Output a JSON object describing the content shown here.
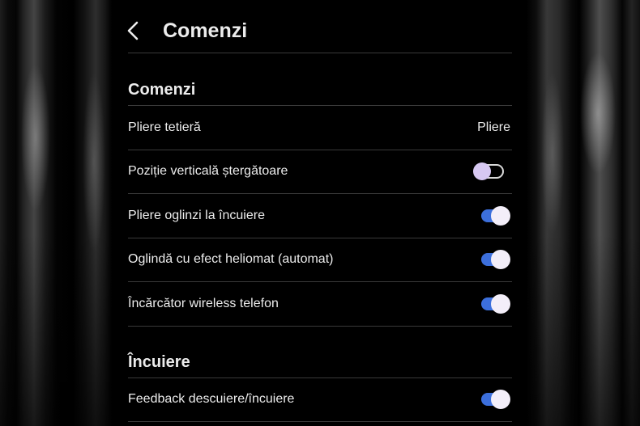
{
  "header": {
    "title": "Comenzi",
    "back_icon": "chevron-left-icon"
  },
  "sections": [
    {
      "title": "Comenzi",
      "rows": [
        {
          "label": "Pliere tetieră",
          "value": "Pliere"
        },
        {
          "label": "Poziție verticală ștergătoare",
          "toggle_on": false
        },
        {
          "label": "Pliere oglinzi la încuiere",
          "toggle_on": true
        },
        {
          "label": "Oglindă cu efect heliomat (automat)",
          "toggle_on": true
        },
        {
          "label": "Încărcător wireless telefon",
          "toggle_on": true
        }
      ]
    },
    {
      "title": "Încuiere",
      "rows": [
        {
          "label": "Feedback descuiere/încuiere",
          "toggle_on": true
        }
      ]
    }
  ],
  "colors": {
    "background": "#000000",
    "text": "#ececec",
    "divider": "#3a3a3a",
    "toggle_on_track": "#3c6fdc",
    "toggle_knob": "#f3eef9",
    "toggle_off_knob": "#d7c8f2"
  }
}
